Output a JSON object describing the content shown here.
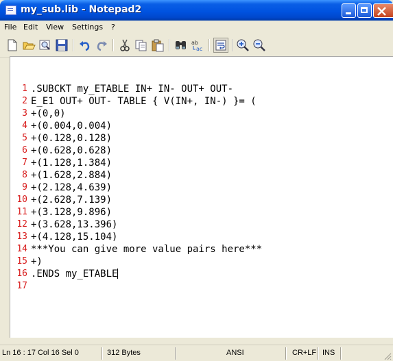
{
  "window": {
    "title": "my_sub.lib - Notepad2"
  },
  "menu": [
    {
      "label": "File"
    },
    {
      "label": "Edit"
    },
    {
      "label": "View"
    },
    {
      "label": "Settings"
    },
    {
      "label": "?"
    }
  ],
  "toolbar": {
    "icons": [
      "new-file-icon",
      "open-folder-icon",
      "find-file-icon",
      "save-icon",
      "undo-icon",
      "redo-icon",
      "cut-icon",
      "copy-icon",
      "paste-icon",
      "find-icon",
      "replace-icon",
      "word-wrap-icon",
      "zoom-in-icon",
      "zoom-out-icon"
    ],
    "pressed": "word-wrap-icon"
  },
  "editor": {
    "lines": [
      {
        "n": "1",
        "text": ".SUBCKT my_ETABLE IN+ IN- OUT+ OUT-"
      },
      {
        "n": "2",
        "text": "E_E1 OUT+ OUT- TABLE { V(IN+, IN-) }= ("
      },
      {
        "n": "3",
        "text": "+(0,0)"
      },
      {
        "n": "4",
        "text": "+(0.004,0.004)"
      },
      {
        "n": "5",
        "text": "+(0.128,0.128)"
      },
      {
        "n": "6",
        "text": "+(0.628,0.628)"
      },
      {
        "n": "7",
        "text": "+(1.128,1.384)"
      },
      {
        "n": "8",
        "text": "+(1.628,2.884)"
      },
      {
        "n": "9",
        "text": "+(2.128,4.639)"
      },
      {
        "n": "10",
        "text": "+(2.628,7.139)"
      },
      {
        "n": "11",
        "text": "+(3.128,9.896)"
      },
      {
        "n": "12",
        "text": "+(3.628,13.396)"
      },
      {
        "n": "13",
        "text": "+(4.128,15.104)"
      },
      {
        "n": "14",
        "text": "***You can give more value pairs here***"
      },
      {
        "n": "15",
        "text": "+)"
      },
      {
        "n": "16",
        "text": ".ENDS my_ETABLE"
      },
      {
        "n": "17",
        "text": ""
      }
    ]
  },
  "status": {
    "position": "Ln 16 : 17  Col 16  Sel 0",
    "size": "312 Bytes",
    "encoding": "ANSI",
    "line_ending": "CR+LF",
    "mode": "INS"
  },
  "colors": {
    "line_number": "#d81b1b",
    "titlebar": "#0053e0"
  }
}
